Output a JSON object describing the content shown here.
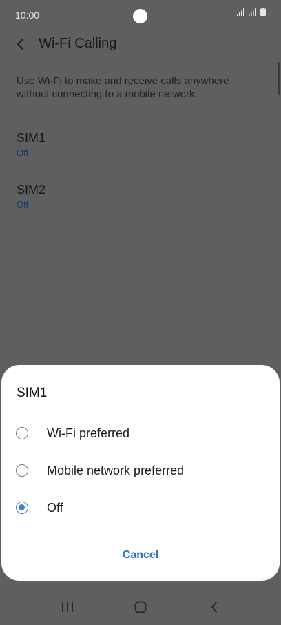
{
  "status_bar": {
    "time": "10:00",
    "icons": [
      "signal-sim1-icon",
      "signal-sim2-icon",
      "battery-icon"
    ]
  },
  "app_bar": {
    "title": "Wi-Fi Calling",
    "back_icon": "back-arrow-icon"
  },
  "description": "Use Wi-Fi to make and receive calls anywhere without connecting to a mobile network.",
  "sims": [
    {
      "name": "SIM1",
      "status": "Off"
    },
    {
      "name": "SIM2",
      "status": "Off"
    }
  ],
  "dialog": {
    "title": "SIM1",
    "options": [
      {
        "label": "Wi-Fi preferred",
        "selected": false
      },
      {
        "label": "Mobile network preferred",
        "selected": false
      },
      {
        "label": "Off",
        "selected": true
      }
    ],
    "cancel_label": "Cancel"
  },
  "nav_bar": {
    "icons": [
      "recent-apps-icon",
      "home-icon",
      "back-icon"
    ]
  },
  "colors": {
    "accent": "#3e80d6",
    "cancel_text": "#2b74c6",
    "scrim": "#5f5f5f"
  }
}
